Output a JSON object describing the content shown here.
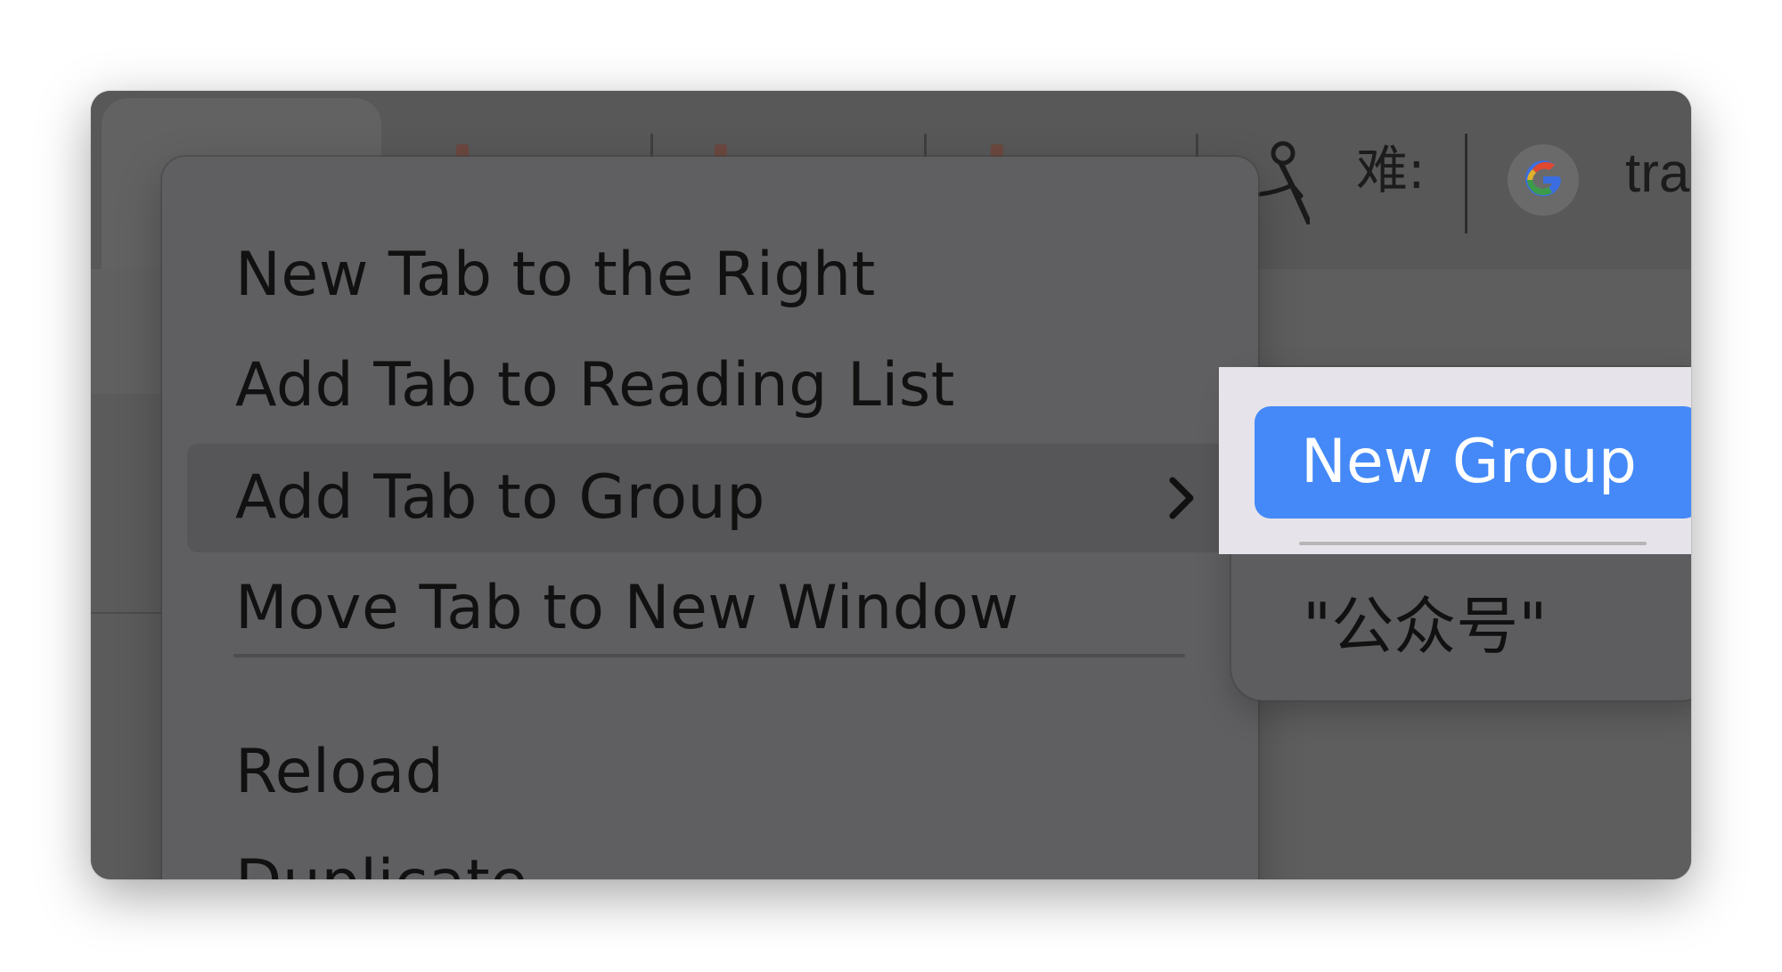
{
  "browser": {
    "tabs": [
      {
        "title": "难:",
        "icon": "figure-icon"
      },
      {
        "title": "tra",
        "icon": "google-icon"
      }
    ]
  },
  "context_menu": {
    "items": [
      {
        "label": "New Tab to the Right"
      },
      {
        "label": "Add Tab to Reading List"
      },
      {
        "label": "Add Tab to Group",
        "has_submenu": true,
        "highlighted": true
      },
      {
        "label": "Move Tab to New Window"
      },
      {
        "label": "Reload"
      },
      {
        "label": "Duplicate"
      }
    ]
  },
  "submenu": {
    "new_group_label": "New Group",
    "groups": [
      {
        "label": "\"公众号\""
      }
    ]
  },
  "colors": {
    "accent": "#4489f7",
    "menu_bg": "#5f5f61",
    "highlight_bg": "#565658"
  }
}
